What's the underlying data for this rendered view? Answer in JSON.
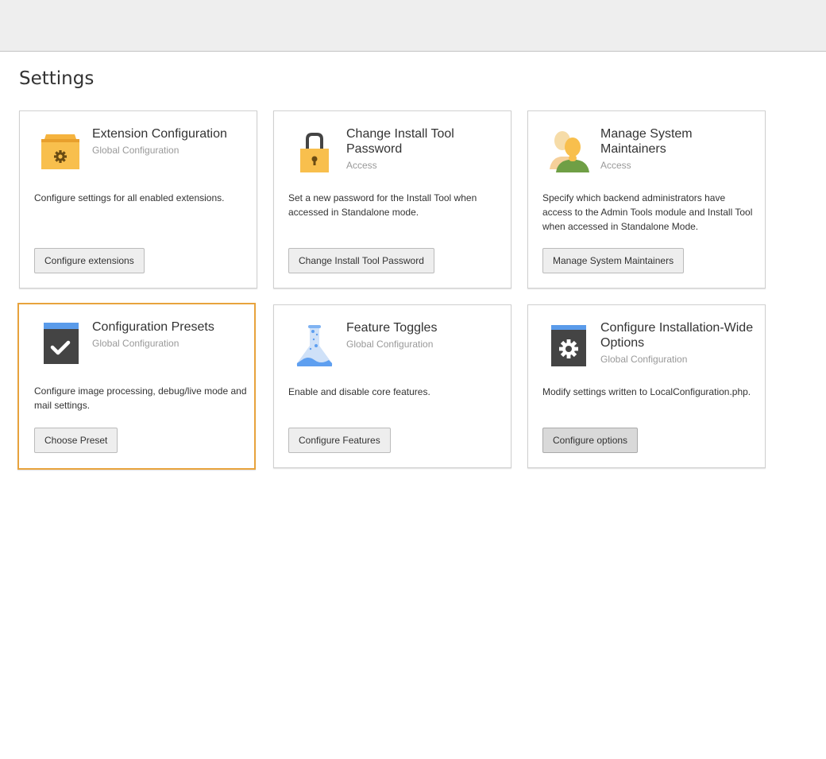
{
  "page": {
    "title": "Settings"
  },
  "cards": [
    {
      "title": "Extension Configuration",
      "subtitle": "Global Configuration",
      "description": "Configure settings for all enabled extensions.",
      "button": "Configure extensions",
      "icon": "package-gear-icon"
    },
    {
      "title": "Change Install Tool Password",
      "subtitle": "Access",
      "description": "Set a new password for the Install Tool when accessed in Standalone mode.",
      "button": "Change Install Tool Password",
      "icon": "lock-icon"
    },
    {
      "title": "Manage System Maintainers",
      "subtitle": "Access",
      "description": "Specify which backend administrators have access to the Admin Tools module and Install Tool when accessed in Standalone Mode.",
      "button": "Manage System Maintainers",
      "icon": "users-icon"
    },
    {
      "title": "Configuration Presets",
      "subtitle": "Global Configuration",
      "description": "Configure image processing, debug/live mode and mail settings.",
      "button": "Choose Preset",
      "icon": "document-check-icon"
    },
    {
      "title": "Feature Toggles",
      "subtitle": "Global Configuration",
      "description": "Enable and disable core features.",
      "button": "Configure Features",
      "icon": "flask-icon"
    },
    {
      "title": "Configure Installation-Wide Options",
      "subtitle": "Global Configuration",
      "description": "Modify settings written to LocalConfiguration.php.",
      "button": "Configure options",
      "icon": "document-gear-icon"
    }
  ],
  "colors": {
    "active_border": "#e8a33d",
    "folder_yellow": "#f8bf4d",
    "doc_dark": "#444444",
    "doc_blue": "#5a9bea",
    "flask_blue": "#5e9ff0",
    "user_green": "#6f9f45"
  }
}
